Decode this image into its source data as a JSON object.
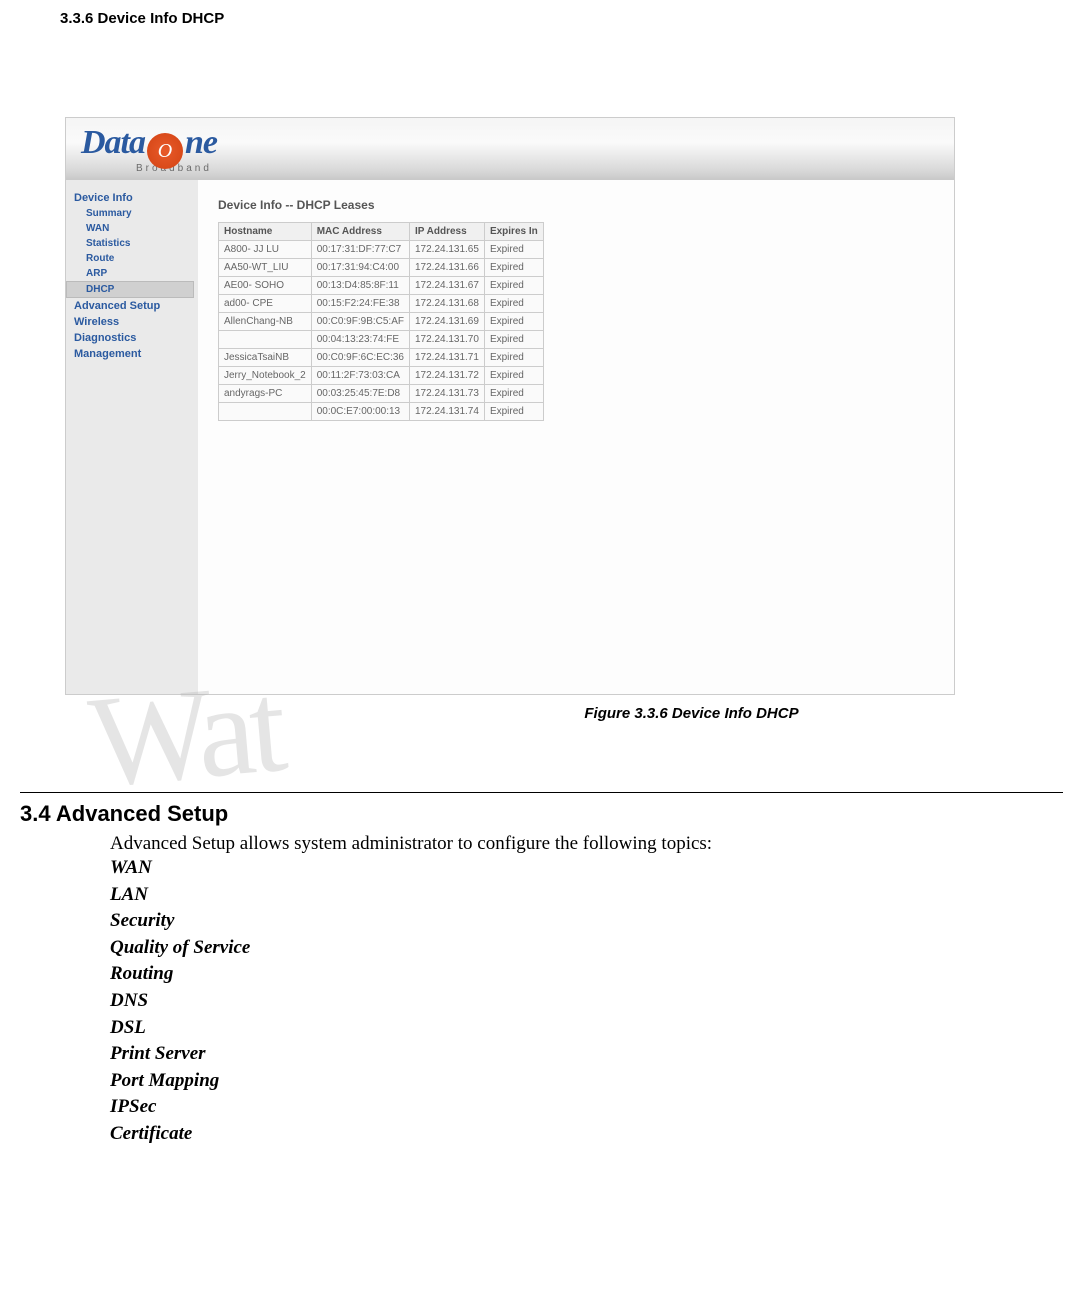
{
  "heading_336": "3.3.6  Device Info DHCP",
  "logo": {
    "part1": "Data",
    "swirl": "O",
    "part2": "ne",
    "sub": "Broadband"
  },
  "sidebar": {
    "device_info": "Device Info",
    "summary": "Summary",
    "wan": "WAN",
    "statistics": "Statistics",
    "route": "Route",
    "arp": "ARP",
    "dhcp": "DHCP",
    "advanced_setup": "Advanced Setup",
    "wireless": "Wireless",
    "diagnostics": "Diagnostics",
    "management": "Management"
  },
  "content_title": "Device Info -- DHCP Leases",
  "cols": {
    "host": "Hostname",
    "mac": "MAC Address",
    "ip": "IP Address",
    "exp": "Expires In"
  },
  "rows": [
    {
      "host": "A800-  JJ LU",
      "mac": "00:17:31:DF:77:C7",
      "ip": "172.24.131.65",
      "exp": "Expired"
    },
    {
      "host": "AA50-WT_LIU",
      "mac": "00:17:31:94:C4:00",
      "ip": "172.24.131.66",
      "exp": "Expired"
    },
    {
      "host": "AE00-  SOHO",
      "mac": "00:13:D4:85:8F:11",
      "ip": "172.24.131.67",
      "exp": "Expired"
    },
    {
      "host": "ad00-  CPE",
      "mac": "00:15:F2:24:FE:38",
      "ip": "172.24.131.68",
      "exp": "Expired"
    },
    {
      "host": "AllenChang-NB",
      "mac": "00:C0:9F:9B:C5:AF",
      "ip": "172.24.131.69",
      "exp": "Expired"
    },
    {
      "host": "",
      "mac": "00:04:13:23:74:FE",
      "ip": "172.24.131.70",
      "exp": "Expired"
    },
    {
      "host": "JessicaTsaiNB",
      "mac": "00:C0:9F:6C:EC:36",
      "ip": "172.24.131.71",
      "exp": "Expired"
    },
    {
      "host": "Jerry_Notebook_2",
      "mac": "00:11:2F:73:03:CA",
      "ip": "172.24.131.72",
      "exp": "Expired"
    },
    {
      "host": "andyrags-PC",
      "mac": "00:03:25:45:7E:D8",
      "ip": "172.24.131.73",
      "exp": "Expired"
    },
    {
      "host": "",
      "mac": "00:0C:E7:00:00:13",
      "ip": "172.24.131.74",
      "exp": "Expired"
    }
  ],
  "figure_caption": "Figure 3.3.6  Device Info DHCP",
  "watermark": "Wat",
  "heading_34": "3.4 Advanced Setup",
  "adv_intro": "Advanced Setup allows system administrator to configure the following topics:",
  "adv_topics": {
    "wan": "WAN",
    "lan": "LAN",
    "security": "Security",
    "qos": "Quality of Service",
    "routing": "Routing",
    "dns": "DNS",
    "dsl": "DSL",
    "print": "Print Server",
    "portmap": "Port Mapping",
    "ipsec": "IPSec",
    "cert": "Certificate"
  }
}
